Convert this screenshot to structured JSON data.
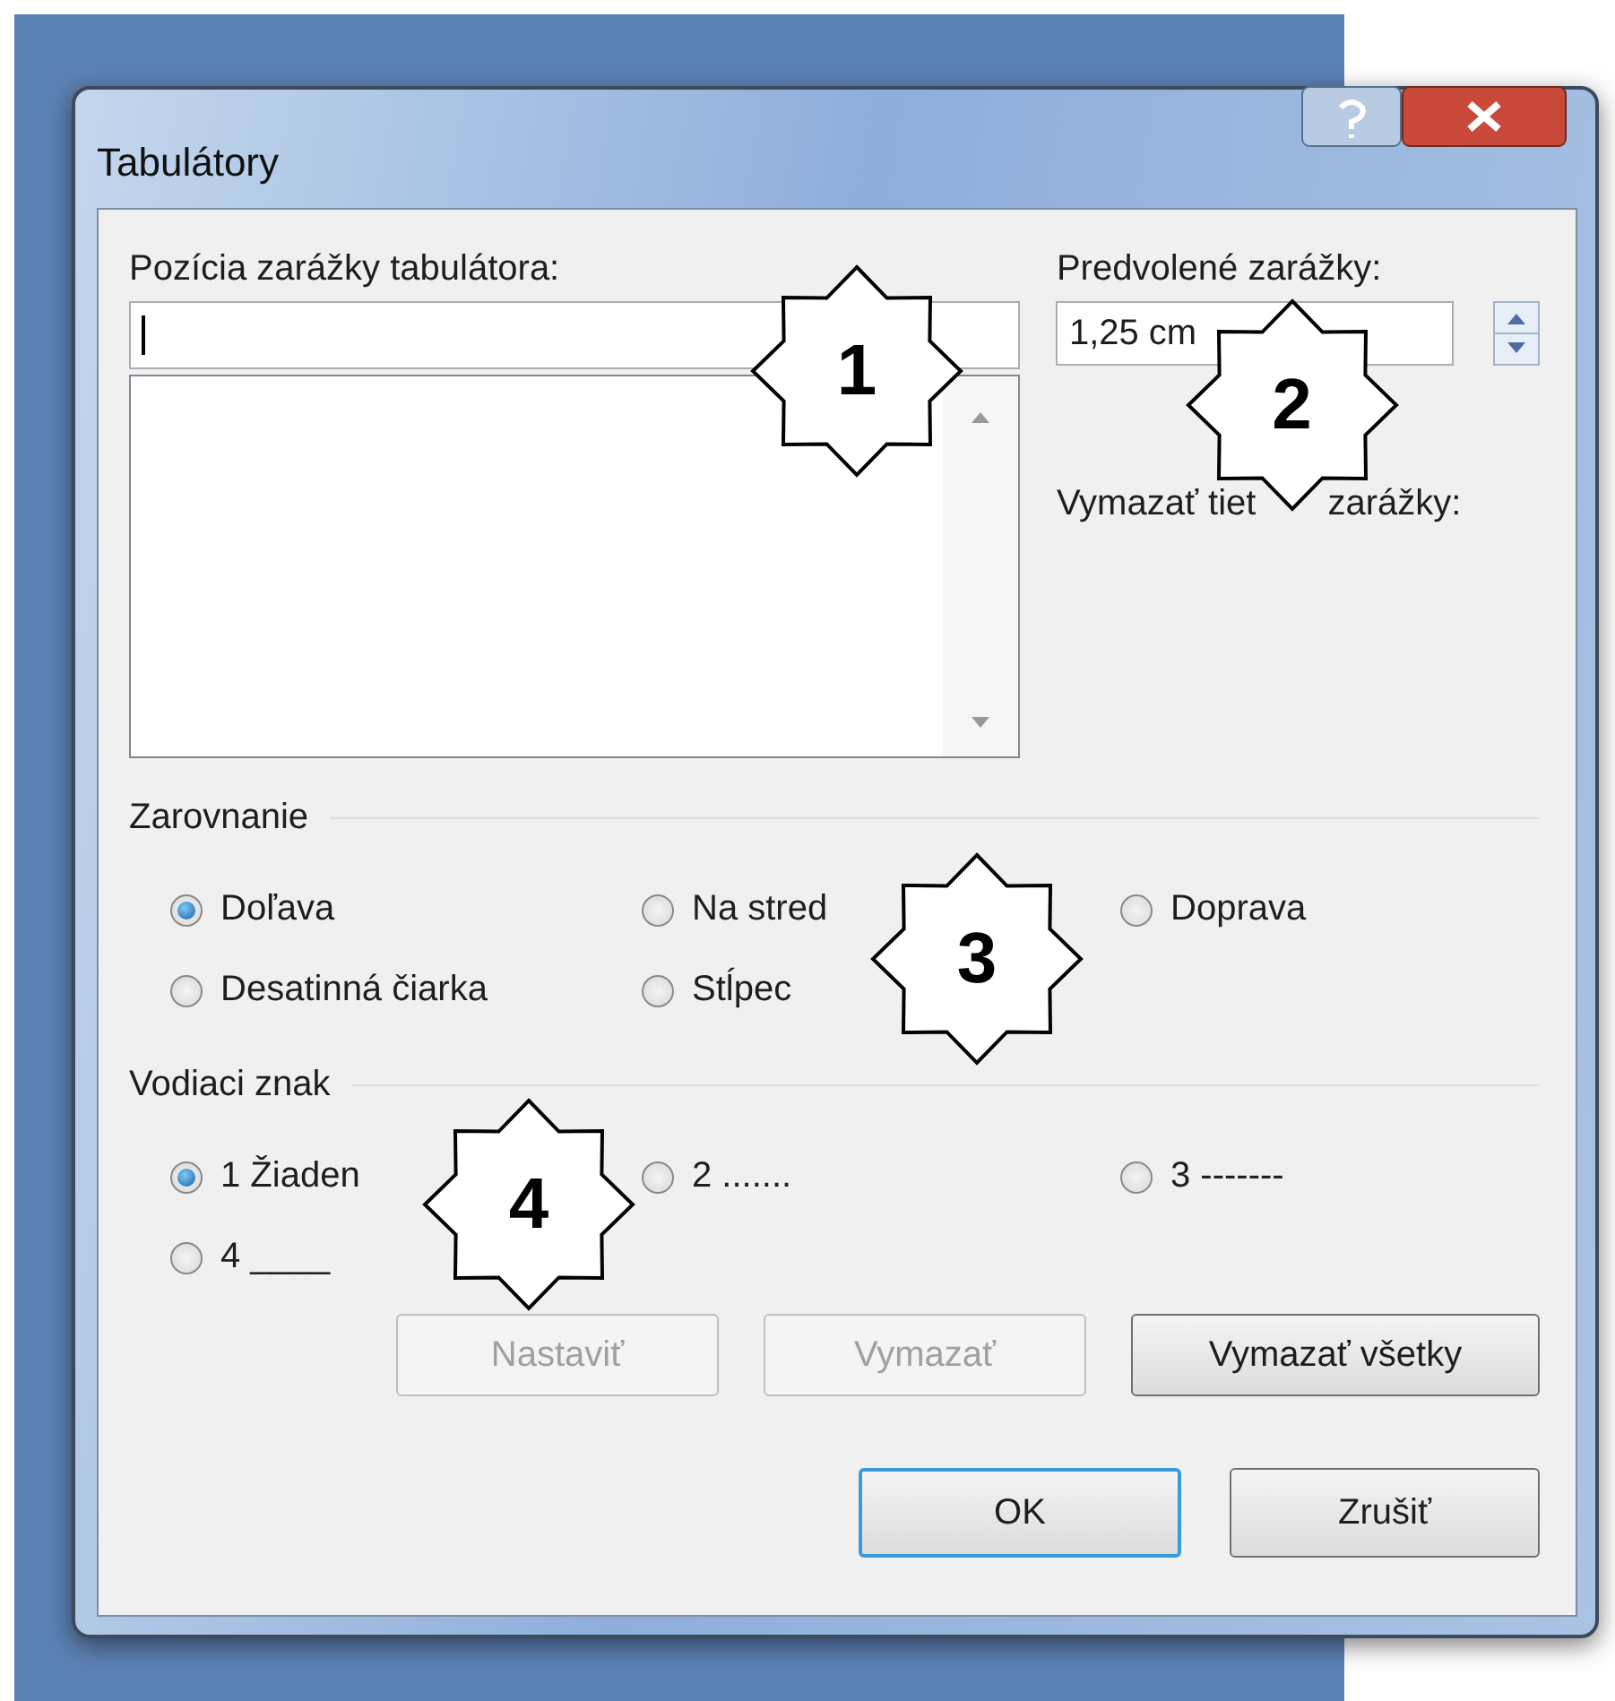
{
  "window": {
    "title": "Tabulátory"
  },
  "tab_position": {
    "label": "Pozícia zarážky tabulátora:"
  },
  "default_stops": {
    "label": "Predvolené zarážky:",
    "value": "1,25 cm"
  },
  "clear_label": {
    "start": "Vymazať tiet",
    "end": "zarážky:"
  },
  "alignment": {
    "title": "Zarovnanie",
    "options": [
      {
        "label": "Doľava",
        "selected": true
      },
      {
        "label": "Na stred",
        "selected": false
      },
      {
        "label": "Doprava",
        "selected": false
      },
      {
        "label": "Desatinná čiarka",
        "selected": false
      },
      {
        "label": "Stĺpec",
        "selected": false
      }
    ]
  },
  "leader": {
    "title": "Vodiaci znak",
    "options": [
      {
        "label": "1 Žiaden",
        "selected": true
      },
      {
        "label": "2 .......",
        "selected": false
      },
      {
        "label": "3 -------",
        "selected": false
      },
      {
        "label": "4 ____",
        "selected": false
      }
    ]
  },
  "buttons": [
    {
      "label": "Nastaviť",
      "disabled": true
    },
    {
      "label": "Vymazať",
      "disabled": true
    },
    {
      "label": "Vymazať všetky",
      "disabled": false
    }
  ],
  "footer_buttons": [
    {
      "label": "OK",
      "default": true
    },
    {
      "label": "Zrušiť",
      "default": false
    }
  ],
  "callouts": [
    "1",
    "2",
    "3",
    "4"
  ]
}
